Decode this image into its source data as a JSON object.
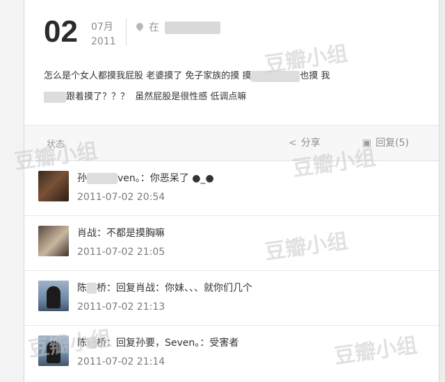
{
  "post": {
    "day": "02",
    "month": "07月",
    "year": "2011",
    "location_prefix": "在",
    "body_line1_a": "怎么是个女人都摸我屁股 老婆摸了 免子家族的摸 摸",
    "body_line1_b": "也摸 我",
    "body_line2_a": "跟着摸了？？？",
    "body_line2_b": "虽然屁股是很性感 低调点嘛"
  },
  "actions": {
    "status_label": "状态",
    "share_label": "分享",
    "reply_label": "回复(5)"
  },
  "comments": [
    {
      "name_a": "孙",
      "name_b": "ven。",
      "sep": "：",
      "text": "你恶呆了 ●_●",
      "time": "2011-07-02 20:54"
    },
    {
      "name_a": "肖战",
      "name_b": "",
      "sep": "：",
      "text": "不都是摸胸嘛",
      "time": "2011-07-02 21:05"
    },
    {
      "name_a": "陈",
      "name_b": "桥",
      "sep": "：",
      "text": "回复肖战：你妹、、、就你们几个",
      "time": "2011-07-02 21:13"
    },
    {
      "name_a": "陈",
      "name_b": "桥",
      "sep": "：",
      "text": "回复孙要，Seven。：受害者",
      "time": "2011-07-02 21:14"
    }
  ],
  "watermark": "豆瓣小组"
}
